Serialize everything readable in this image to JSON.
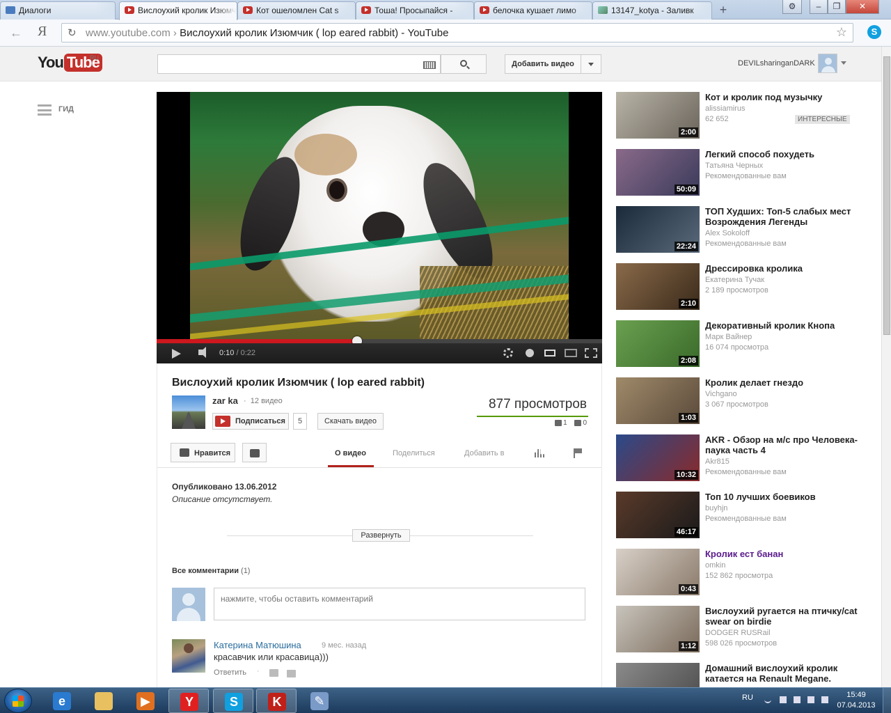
{
  "browser": {
    "tabs": [
      {
        "label": "Диалоги",
        "icon": "message-icon"
      },
      {
        "label": "Вислоухий кролик Изюмчик ( lop eared rabbit) - YouTube",
        "icon": "youtube-icon",
        "active": true
      },
      {
        "label": "Кот ошеломлен Cat s",
        "icon": "youtube-icon"
      },
      {
        "label": "Тоша! Просыпайся -",
        "icon": "youtube-icon"
      },
      {
        "label": "белочка кушает лимо",
        "icon": "youtube-icon"
      },
      {
        "label": "13147_kotya - Заливк",
        "icon": "image-icon"
      }
    ],
    "yandex_button": "Я",
    "url_host": "www.youtube.com",
    "url_separator": "›",
    "url_path": "Вислоухий кролик Изюмчик ( lop eared rabbit) - YouTube"
  },
  "header": {
    "logo_you": "You",
    "logo_tube": "Tube",
    "region": "RU",
    "search_placeholder": "",
    "upload_label": "Добавить видео",
    "username": "DEVILsharinganDARK"
  },
  "guide": {
    "label": "ГИД"
  },
  "player": {
    "current_time": "0:10",
    "separator": " / ",
    "duration": "0:22",
    "progress": 0.45,
    "buffered": 1.0
  },
  "video": {
    "title": "Вислоухий кролик Изюмчик ( lop eared rabbit)",
    "channel": "zar ka",
    "channel_videos_sep": "·",
    "channel_videos": "12 видео",
    "subscribe_label": "Подписаться",
    "subscribers": "5",
    "download_label": "Скачать видео",
    "views": "877 просмотров",
    "likes": "1",
    "dislikes": "0",
    "like_label": "Нравится",
    "tabs": [
      "О видео",
      "Поделиться",
      "Добавить в"
    ],
    "published": "Опубликовано 13.06.2012",
    "description": "Описание отсутствует.",
    "expand_label": "Развернуть"
  },
  "comments": {
    "heading": "Все комментарии",
    "count": "(1)",
    "input_placeholder": "нажмите, чтобы оставить комментарий",
    "items": [
      {
        "author": "Катерина Матюшина",
        "time": "9 мес. назад",
        "text": "красавчик или красавица)))",
        "reply_label": "Ответить",
        "dot": "·"
      }
    ]
  },
  "related": [
    {
      "title": "Кот и кролик под музычку",
      "channel": "alissiamirus",
      "meta": "62 652",
      "badge": "ИНТЕРЕСНЫЕ",
      "duration": "2:00",
      "thumb": [
        "#b9b4a8",
        "#6a645a"
      ]
    },
    {
      "title": "Легкий способ похудеть",
      "channel": "Татьяна Черных",
      "meta": "Рекомендованные вам",
      "duration": "50:09",
      "thumb": [
        "#8a6a8a",
        "#3a3a5a"
      ]
    },
    {
      "title": "ТОП Худших: Топ-5 слабых мест Возрождения Легенды",
      "channel": "Alex Sokoloff",
      "meta": "Рекомендованные вам",
      "duration": "22:24",
      "thumb": [
        "#1a2a3a",
        "#5a6a7a"
      ]
    },
    {
      "title": "Дрессировка кролика",
      "channel": "Екатерина Тучак",
      "meta": "2 189 просмотров",
      "duration": "2:10",
      "thumb": [
        "#8a6a4a",
        "#3a2a1a"
      ]
    },
    {
      "title": "Декоративный кролик Кнопа",
      "channel": "Марк Вайнер",
      "meta": "16 074 просмотра",
      "duration": "2:08",
      "thumb": [
        "#6aa050",
        "#3a6a2a"
      ]
    },
    {
      "title": "Кролик делает гнездо",
      "channel": "Vichgano",
      "meta": "3 067 просмотров",
      "duration": "1:03",
      "thumb": [
        "#a08a6a",
        "#5a4a3a"
      ]
    },
    {
      "title": "AKR - Обзор на м/с про Человека-паука часть 4",
      "channel": "Akr815",
      "meta": "Рекомендованные вам",
      "duration": "10:32",
      "thumb": [
        "#2a4a8a",
        "#8a2a2a"
      ]
    },
    {
      "title": "Топ 10 лучших боевиков",
      "channel": "buyhjn",
      "meta": "Рекомендованные вам",
      "duration": "46:17",
      "thumb": [
        "#5a3a2a",
        "#1a1a1a"
      ]
    },
    {
      "title": "Кролик ест банан",
      "channel": "omkin",
      "meta": "152 862 просмотра",
      "duration": "0:43",
      "thumb": [
        "#d8d0c8",
        "#8a7a6a"
      ],
      "visited": true
    },
    {
      "title": "Вислоухий ругается на птичку/cat swear on birdie",
      "channel": "DODGER RUSRail",
      "meta": "598 026 просмотров",
      "duration": "1:12",
      "thumb": [
        "#c8c4bc",
        "#7a6a5a"
      ]
    },
    {
      "title": "Домашний вислоухий кролик катается на Renault Megane.",
      "channel": "",
      "meta": "",
      "duration": "",
      "thumb": [
        "#8a8a8a",
        "#4a4a4a"
      ]
    }
  ],
  "taskbar": {
    "lang": "RU",
    "time": "15:49",
    "date": "07.04.2013",
    "apps": [
      {
        "name": "ie-icon",
        "glyph": "e",
        "color": "#2a7ad0"
      },
      {
        "name": "explorer-icon",
        "glyph": "",
        "color": "#e8c060"
      },
      {
        "name": "media-player-icon",
        "glyph": "▶",
        "color": "#e07020"
      },
      {
        "name": "yandex-browser-icon",
        "glyph": "Y",
        "color": "#e02020"
      },
      {
        "name": "skype-icon",
        "glyph": "S",
        "color": "#10a0e0"
      },
      {
        "name": "kaspersky-icon",
        "glyph": "K",
        "color": "#c0201a"
      },
      {
        "name": "paint-icon",
        "glyph": "✎",
        "color": "#7a9ac8"
      }
    ]
  }
}
